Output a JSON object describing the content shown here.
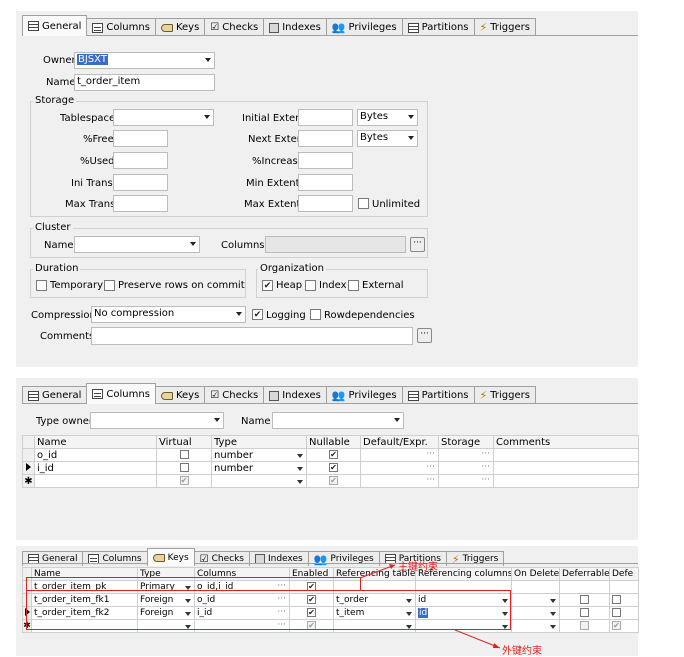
{
  "tabs": {
    "general": "General",
    "columns": "Columns",
    "keys": "Keys",
    "checks": "Checks",
    "indexes": "Indexes",
    "privileges": "Privileges",
    "partitions": "Partitions",
    "triggers": "Triggers"
  },
  "general": {
    "owner_label": "Owner",
    "owner_value": "BJSXT",
    "name_label": "Name",
    "name_value": "t_order_item",
    "storage": {
      "title": "Storage",
      "tablespace": "Tablespace",
      "free": "%Free",
      "used": "%Used",
      "ini_trans": "Ini Trans",
      "max_trans": "Max Trans",
      "initial_extent": "Initial Extent",
      "next_extent": "Next Extent",
      "increase": "%Increase",
      "min_extents": "Min Extents",
      "max_extents": "Max Extents",
      "unit1": "Bytes",
      "unit2": "Bytes",
      "unlimited": "Unlimited"
    },
    "cluster": {
      "title": "Cluster",
      "name": "Name",
      "columns": "Columns"
    },
    "duration": {
      "title": "Duration",
      "temporary": "Temporary",
      "preserve": "Preserve rows on commit"
    },
    "organization": {
      "title": "Organization",
      "heap": "Heap",
      "index": "Index",
      "external": "External"
    },
    "compression_label": "Compression",
    "compression_value": "No compression",
    "logging": "Logging",
    "rowdependencies": "Rowdependencies",
    "comments": "Comments"
  },
  "columns_panel": {
    "type_owner": "Type owner",
    "name": "Name",
    "headers": [
      "Name",
      "Virtual",
      "Type",
      "Nullable",
      "Default/Expr.",
      "Storage",
      "Comments"
    ],
    "rows": [
      {
        "name": "o_id",
        "type": "number",
        "virtual": false,
        "nullable": true
      },
      {
        "name": "i_id",
        "type": "number",
        "virtual": false,
        "nullable": true
      }
    ]
  },
  "keys_panel": {
    "headers": [
      "Name",
      "Type",
      "Columns",
      "Enabled",
      "Referencing table",
      "Referencing columns",
      "On Delete",
      "Deferrable",
      "Defe"
    ],
    "rows": [
      {
        "name": "t_order_item_pk",
        "type": "Primary",
        "columns": "o_id,i_id",
        "ref_table": "",
        "ref_columns": ""
      },
      {
        "name": "t_order_item_fk1",
        "type": "Foreign",
        "columns": "o_id",
        "ref_table": "t_order",
        "ref_columns": "id"
      },
      {
        "name": "t_order_item_fk2",
        "type": "Foreign",
        "columns": "i_id",
        "ref_table": "t_item",
        "ref_columns": "id"
      }
    ]
  },
  "annotations": {
    "primary_key": "主键约束",
    "foreign_key": "外键约束"
  },
  "colors": {
    "selection": "#3a6cc8",
    "annotation": "#e02020",
    "panel": "#f0f0f0"
  }
}
